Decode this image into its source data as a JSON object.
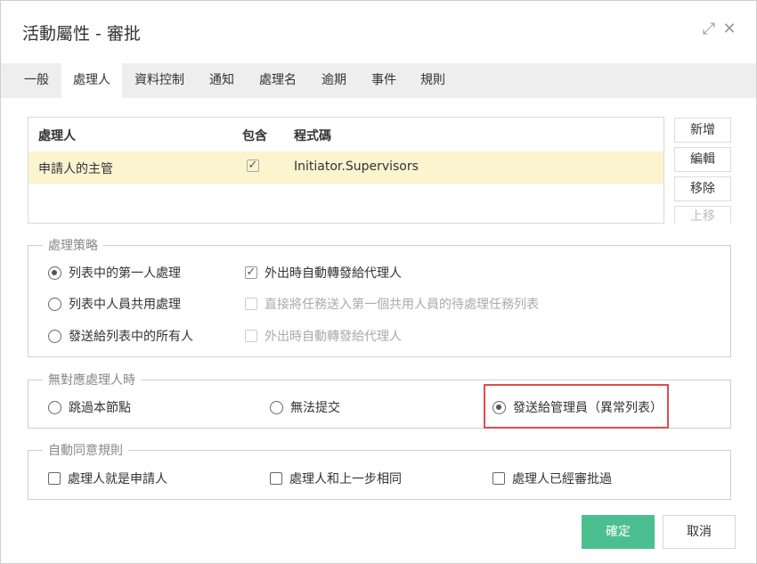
{
  "window": {
    "title": "活動屬性 - 審批",
    "maximize_icon": "⤢",
    "close_icon": "✕"
  },
  "tabs": [
    {
      "label": "一般",
      "active": false
    },
    {
      "label": "處理人",
      "active": true
    },
    {
      "label": "資料控制",
      "active": false
    },
    {
      "label": "通知",
      "active": false
    },
    {
      "label": "處理名",
      "active": false
    },
    {
      "label": "逾期",
      "active": false
    },
    {
      "label": "事件",
      "active": false
    },
    {
      "label": "規則",
      "active": false
    }
  ],
  "grid": {
    "headers": {
      "handler": "處理人",
      "include": "包含",
      "code": "程式碼"
    },
    "rows": [
      {
        "handler": "申請人的主管",
        "include_checked": true,
        "code": "Initiator.Supervisors"
      }
    ]
  },
  "side_buttons": {
    "add": "新增",
    "edit": "編輯",
    "remove": "移除",
    "move_up": "上移"
  },
  "strategy": {
    "legend": "處理策略",
    "options": [
      {
        "label": "列表中的第一人處理",
        "checked": true
      },
      {
        "label": "列表中人員共用處理",
        "checked": false
      },
      {
        "label": "發送給列表中的所有人",
        "checked": false
      }
    ],
    "checks": [
      {
        "label": "外出時自動轉發給代理人",
        "checked": true,
        "enabled": true
      },
      {
        "label": "直接將任務送入第一個共用人員的待處理任務列表",
        "checked": false,
        "enabled": false
      },
      {
        "label": "外出時自動轉發給代理人",
        "checked": false,
        "enabled": false
      }
    ]
  },
  "no_handler": {
    "legend": "無對應處理人時",
    "options": [
      {
        "label": "跳過本節點",
        "checked": false
      },
      {
        "label": "無法提交",
        "checked": false
      },
      {
        "label": "發送給管理員（異常列表）",
        "checked": true
      }
    ]
  },
  "auto_approve": {
    "legend": "自動同意規則",
    "options": [
      {
        "label": "處理人就是申請人",
        "checked": false
      },
      {
        "label": "處理人和上一步相同",
        "checked": false
      },
      {
        "label": "處理人已經審批過",
        "checked": false
      }
    ]
  },
  "footer": {
    "ok": "確定",
    "cancel": "取消"
  },
  "colors": {
    "accent": "#4cbf91",
    "highlight": "#e24b4b",
    "selected_row": "#fcf3cf"
  }
}
